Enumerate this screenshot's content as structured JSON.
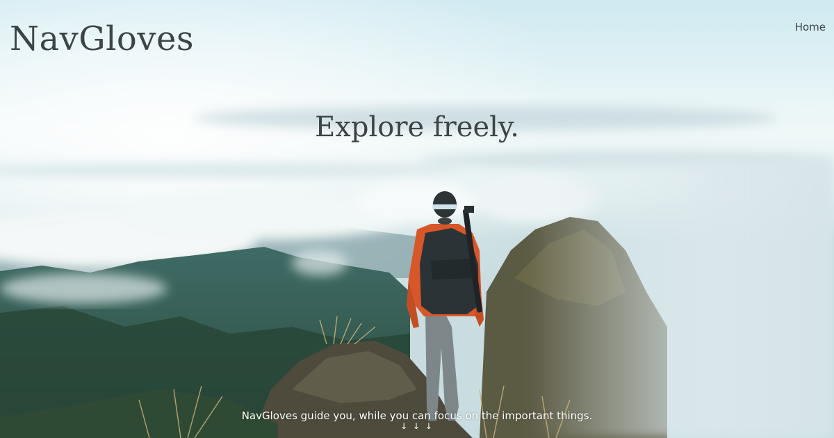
{
  "brand": {
    "title": "NavGloves"
  },
  "nav": {
    "home_label": "Home"
  },
  "hero": {
    "headline": "Explore freely.",
    "subline": "NavGloves guide you, while you can focus on the important things.",
    "scroll_arrows": "↓ ↓ ↓",
    "image_subject": "hiker on mountain peak above clouds"
  }
}
